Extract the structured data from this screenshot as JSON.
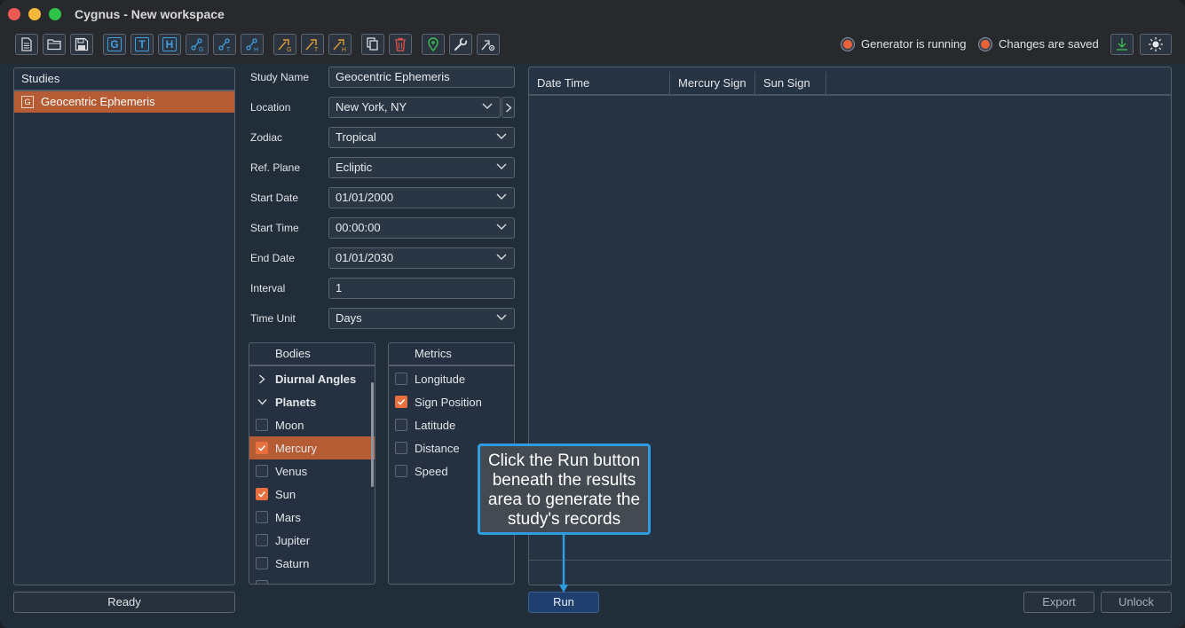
{
  "window": {
    "title": "Cygnus - New workspace"
  },
  "toolbar": {
    "buttons": [
      {
        "icon": "new-file-icon"
      },
      {
        "icon": "open-folder-icon"
      },
      {
        "icon": "save-icon"
      },
      {
        "icon": "geocentric-study-icon",
        "label": "G"
      },
      {
        "icon": "topocentric-study-icon",
        "label": "T"
      },
      {
        "icon": "heliocentric-study-icon",
        "label": "H"
      },
      {
        "icon": "geocentric-chart-icon"
      },
      {
        "icon": "topocentric-chart-icon"
      },
      {
        "icon": "heliocentric-chart-icon"
      },
      {
        "icon": "geocentric-event-icon"
      },
      {
        "icon": "topocentric-event-icon"
      },
      {
        "icon": "heliocentric-event-icon"
      },
      {
        "icon": "copy-icon"
      },
      {
        "icon": "delete-icon"
      },
      {
        "icon": "location-pin-icon"
      },
      {
        "icon": "wrench-icon"
      },
      {
        "icon": "settings-chart-icon"
      }
    ],
    "status_generator": "Generator is running",
    "status_saved": "Changes are saved",
    "download_icon": "download-icon",
    "theme_icon": "sun-icon"
  },
  "studies": {
    "header": "Studies",
    "items": [
      {
        "label": "Geocentric Ephemeris",
        "badge": "G"
      }
    ],
    "status": "Ready"
  },
  "form": {
    "study_name_label": "Study Name",
    "study_name": "Geocentric Ephemeris",
    "location_label": "Location",
    "location": "New York, NY",
    "zodiac_label": "Zodiac",
    "zodiac": "Tropical",
    "ref_plane_label": "Ref. Plane",
    "ref_plane": "Ecliptic",
    "start_date_label": "Start Date",
    "start_date": "01/01/2000",
    "start_time_label": "Start Time",
    "start_time": "00:00:00",
    "end_date_label": "End Date",
    "end_date": "01/01/2030",
    "interval_label": "Interval",
    "interval": "1",
    "time_unit_label": "Time Unit",
    "time_unit": "Days"
  },
  "bodies": {
    "header": "Bodies",
    "groups": [
      {
        "label": "Diurnal Angles",
        "expanded": false
      },
      {
        "label": "Planets",
        "expanded": true
      }
    ],
    "items": [
      {
        "label": "Moon",
        "checked": false,
        "selected": false
      },
      {
        "label": "Mercury",
        "checked": true,
        "selected": true
      },
      {
        "label": "Venus",
        "checked": false,
        "selected": false
      },
      {
        "label": "Sun",
        "checked": true,
        "selected": false
      },
      {
        "label": "Mars",
        "checked": false,
        "selected": false
      },
      {
        "label": "Jupiter",
        "checked": false,
        "selected": false
      },
      {
        "label": "Saturn",
        "checked": false,
        "selected": false
      }
    ]
  },
  "metrics": {
    "header": "Metrics",
    "items": [
      {
        "label": "Longitude",
        "checked": false
      },
      {
        "label": "Sign Position",
        "checked": true
      },
      {
        "label": "Latitude",
        "checked": false
      },
      {
        "label": "Distance",
        "checked": false
      },
      {
        "label": "Speed",
        "checked": false
      }
    ]
  },
  "results": {
    "columns": [
      "Date Time",
      "Mercury Sign",
      "Sun Sign"
    ]
  },
  "actions": {
    "run": "Run",
    "export": "Export",
    "unlock": "Unlock"
  },
  "callout": {
    "text": "Click the Run button beneath the results area to generate the study's records"
  },
  "colors": {
    "accent": "#b65c34",
    "checkbox_on": "#e8703e",
    "callout_border": "#2f9be0",
    "run_button": "#1f3f6e"
  }
}
